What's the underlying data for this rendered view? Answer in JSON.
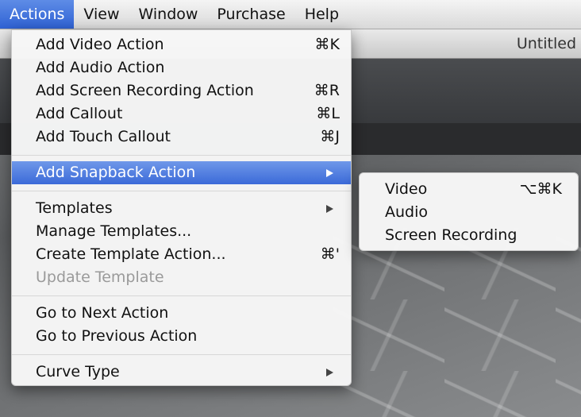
{
  "menubar": {
    "items": [
      {
        "label": "Actions",
        "active": true
      },
      {
        "label": "View"
      },
      {
        "label": "Window"
      },
      {
        "label": "Purchase"
      },
      {
        "label": "Help"
      }
    ]
  },
  "app": {
    "title": "Untitled"
  },
  "actions_menu": {
    "groups": [
      [
        {
          "label": "Add Video Action",
          "shortcut": "⌘K"
        },
        {
          "label": "Add Audio Action",
          "shortcut": ""
        },
        {
          "label": "Add Screen Recording Action",
          "shortcut": "⌘R"
        },
        {
          "label": "Add Callout",
          "shortcut": "⌘L"
        },
        {
          "label": "Add Touch Callout",
          "shortcut": "⌘J"
        }
      ],
      [
        {
          "label": "Add Snapback Action",
          "submenu": true,
          "highlighted": true
        }
      ],
      [
        {
          "label": "Templates",
          "submenu": true
        },
        {
          "label": "Manage Templates...",
          "shortcut": ""
        },
        {
          "label": "Create Template Action...",
          "shortcut": "⌘'"
        },
        {
          "label": "Update Template",
          "disabled": true
        }
      ],
      [
        {
          "label": "Go to Next Action",
          "shortcut": ""
        },
        {
          "label": "Go to Previous Action",
          "shortcut": ""
        }
      ],
      [
        {
          "label": "Curve Type",
          "submenu": true
        }
      ]
    ]
  },
  "snapback_submenu": {
    "items": [
      {
        "label": "Video",
        "shortcut": "⌥⌘K"
      },
      {
        "label": "Audio",
        "shortcut": ""
      },
      {
        "label": "Screen Recording",
        "shortcut": ""
      }
    ]
  }
}
